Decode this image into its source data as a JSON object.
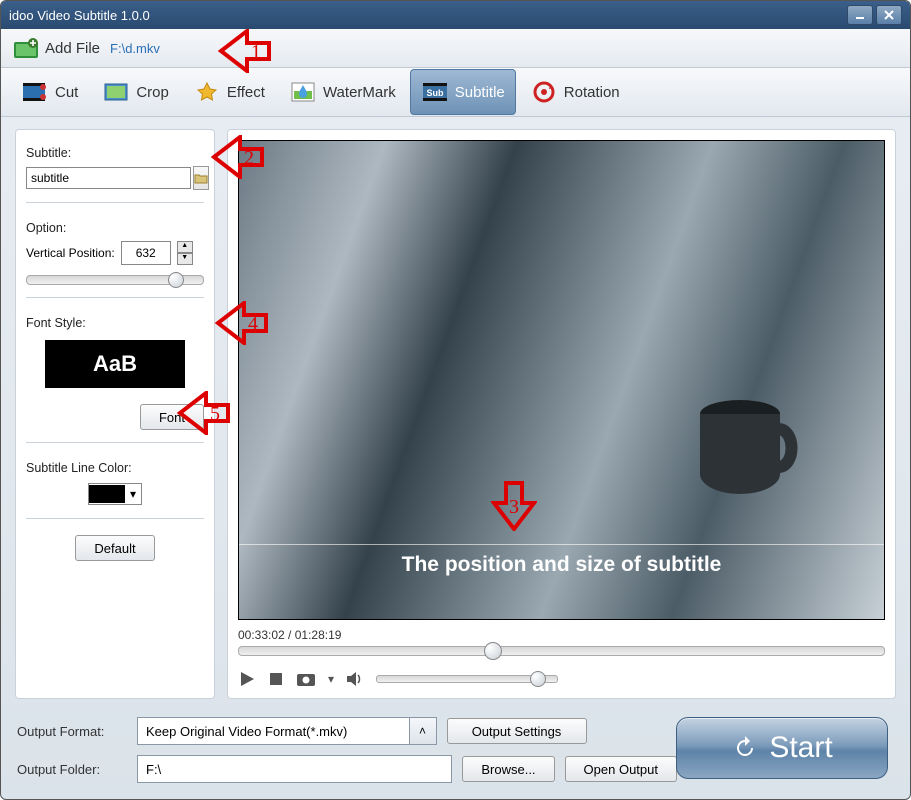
{
  "window": {
    "title": "idoo Video Subtitle 1.0.0"
  },
  "addfile": {
    "label": "Add File",
    "path": "F:\\d.mkv"
  },
  "tabs": {
    "cut": "Cut",
    "crop": "Crop",
    "effect": "Effect",
    "watermark": "WaterMark",
    "subtitle": "Subtitle",
    "rotation": "Rotation"
  },
  "side": {
    "subtitle_label": "Subtitle:",
    "subtitle_value": "subtitle",
    "option_label": "Option:",
    "vpos_label": "Vertical Position:",
    "vpos_value": "632",
    "fontstyle_label": "Font Style:",
    "fontpreview_text": "AaB",
    "font_btn": "Font",
    "linecolor_label": "Subtitle Line Color:",
    "linecolor_value": "#000000",
    "default_btn": "Default"
  },
  "preview": {
    "subtitle_overlay": "The position and size of subtitle",
    "time_current": "00:33:02",
    "time_total": "01:28:19"
  },
  "bottom": {
    "format_label": "Output Format:",
    "format_value": "Keep Original Video Format(*.mkv)",
    "output_settings_btn": "Output Settings",
    "folder_label": "Output Folder:",
    "folder_value": "F:\\",
    "browse_btn": "Browse...",
    "open_output_btn": "Open Output",
    "start_btn": "Start"
  },
  "annotations": {
    "a1": "1",
    "a2": "2",
    "a3": "3",
    "a4": "4",
    "a5": "5"
  }
}
